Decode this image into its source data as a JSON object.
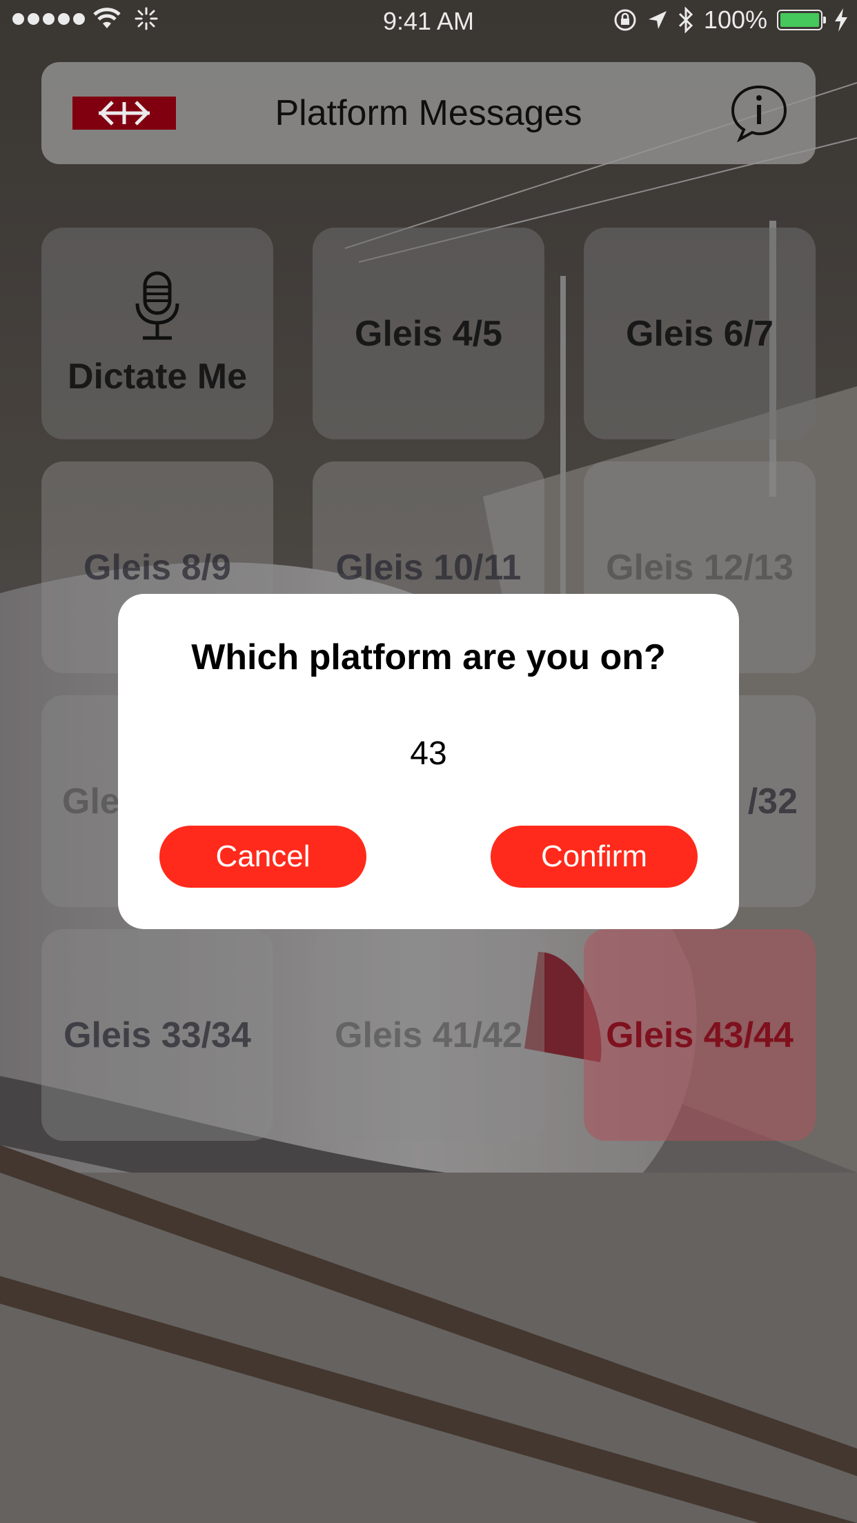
{
  "status_bar": {
    "time": "9:41 AM",
    "battery_text": "100%",
    "battery_level": 1.0,
    "icons": [
      "signal-dots",
      "wifi-icon",
      "activity-spinner-icon",
      "rotation-lock-icon",
      "location-arrow-icon",
      "bluetooth-icon",
      "battery-icon",
      "charging-bolt-icon"
    ]
  },
  "header": {
    "logo": "sbb-logo",
    "title": "Platform Messages",
    "info_icon": "info-speech-bubble-icon"
  },
  "tiles": [
    {
      "label": "Dictate Me",
      "icon": "microphone-icon"
    },
    {
      "label": "Gleis 4/5"
    },
    {
      "label": "Gleis 6/7"
    },
    {
      "label": "Gleis 8/9"
    },
    {
      "label": "Gleis 10/11"
    },
    {
      "label": "Gleis 12/13"
    },
    {
      "label": "Gle"
    },
    {
      "label": "/32"
    },
    {
      "label": "Gleis 33/34"
    },
    {
      "label": "Gleis 41/42"
    },
    {
      "label": "Gleis 43/44"
    }
  ],
  "dialog": {
    "title": "Which platform are you on?",
    "value": "43",
    "cancel_label": "Cancel",
    "confirm_label": "Confirm"
  },
  "colors": {
    "accent_red": "#ff2a1b",
    "logo_red": "#8b0012",
    "battery_green": "#4cd964"
  }
}
